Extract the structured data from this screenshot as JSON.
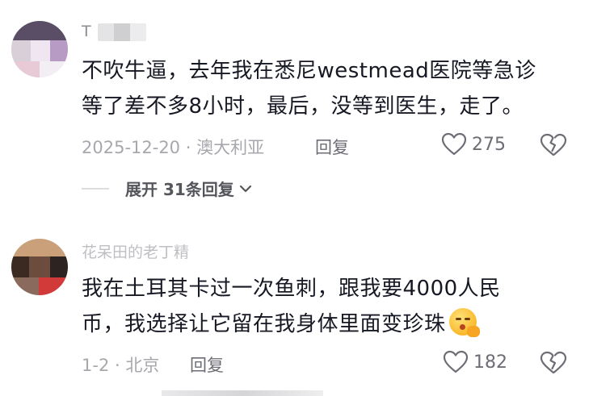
{
  "comments": [
    {
      "username": "T",
      "text_line1": "不吹牛逼，去年我在悉尼westmead医院等急诊",
      "text_line2": "等了差不多8小时，最后，没等到医生，走了。",
      "date_location": "2025-12-20 · 澳大利亚",
      "reply_label": "回复",
      "like_count": "275",
      "expand_label": "展开 31条回复"
    },
    {
      "username": "花呆田的老丁精",
      "text_line1": "我在土耳其卡过一次鱼刺，跟我要4000人民",
      "text_line2": "币，我选择让它留在我身体里面变珍珠",
      "date_location": "1-2 · 北京",
      "reply_label": "回复",
      "like_count": "182"
    }
  ],
  "colors": {
    "text": "#161823",
    "meta": "#a7a8ad",
    "action": "#6d6e75"
  },
  "icons": [
    "heart-outline-icon",
    "broken-heart-icon",
    "chevron-down-icon",
    "shush-emoji-icon"
  ]
}
